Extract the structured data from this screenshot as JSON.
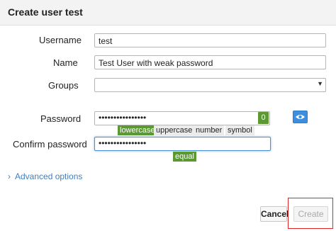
{
  "dialog": {
    "title": "Create user test"
  },
  "form": {
    "username_label": "Username",
    "username_value": "test",
    "name_label": "Name",
    "name_value": "Test User with weak password",
    "groups_label": "Groups",
    "groups_value": "",
    "password_label": "Password",
    "password_value": "••••••••••••••••",
    "password_score": "0",
    "checks": [
      {
        "label": "lowercase",
        "passed": true
      },
      {
        "label": "uppercase",
        "passed": false
      },
      {
        "label": "number",
        "passed": false
      },
      {
        "label": "symbol",
        "passed": false
      }
    ],
    "confirm_label": "Confirm password",
    "confirm_value": "••••••••••••••••",
    "match_label": "equal"
  },
  "advanced": {
    "label": "Advanced options"
  },
  "buttons": {
    "cancel": "Cancel",
    "create": "Create"
  },
  "colors": {
    "ok": "#5a9a31",
    "accent": "#3d8ee0",
    "highlight": "#e02525"
  },
  "icons": {
    "reveal": "eye-icon",
    "dropdown": "chevron-down-icon",
    "advanced": "chevron-right-icon"
  }
}
